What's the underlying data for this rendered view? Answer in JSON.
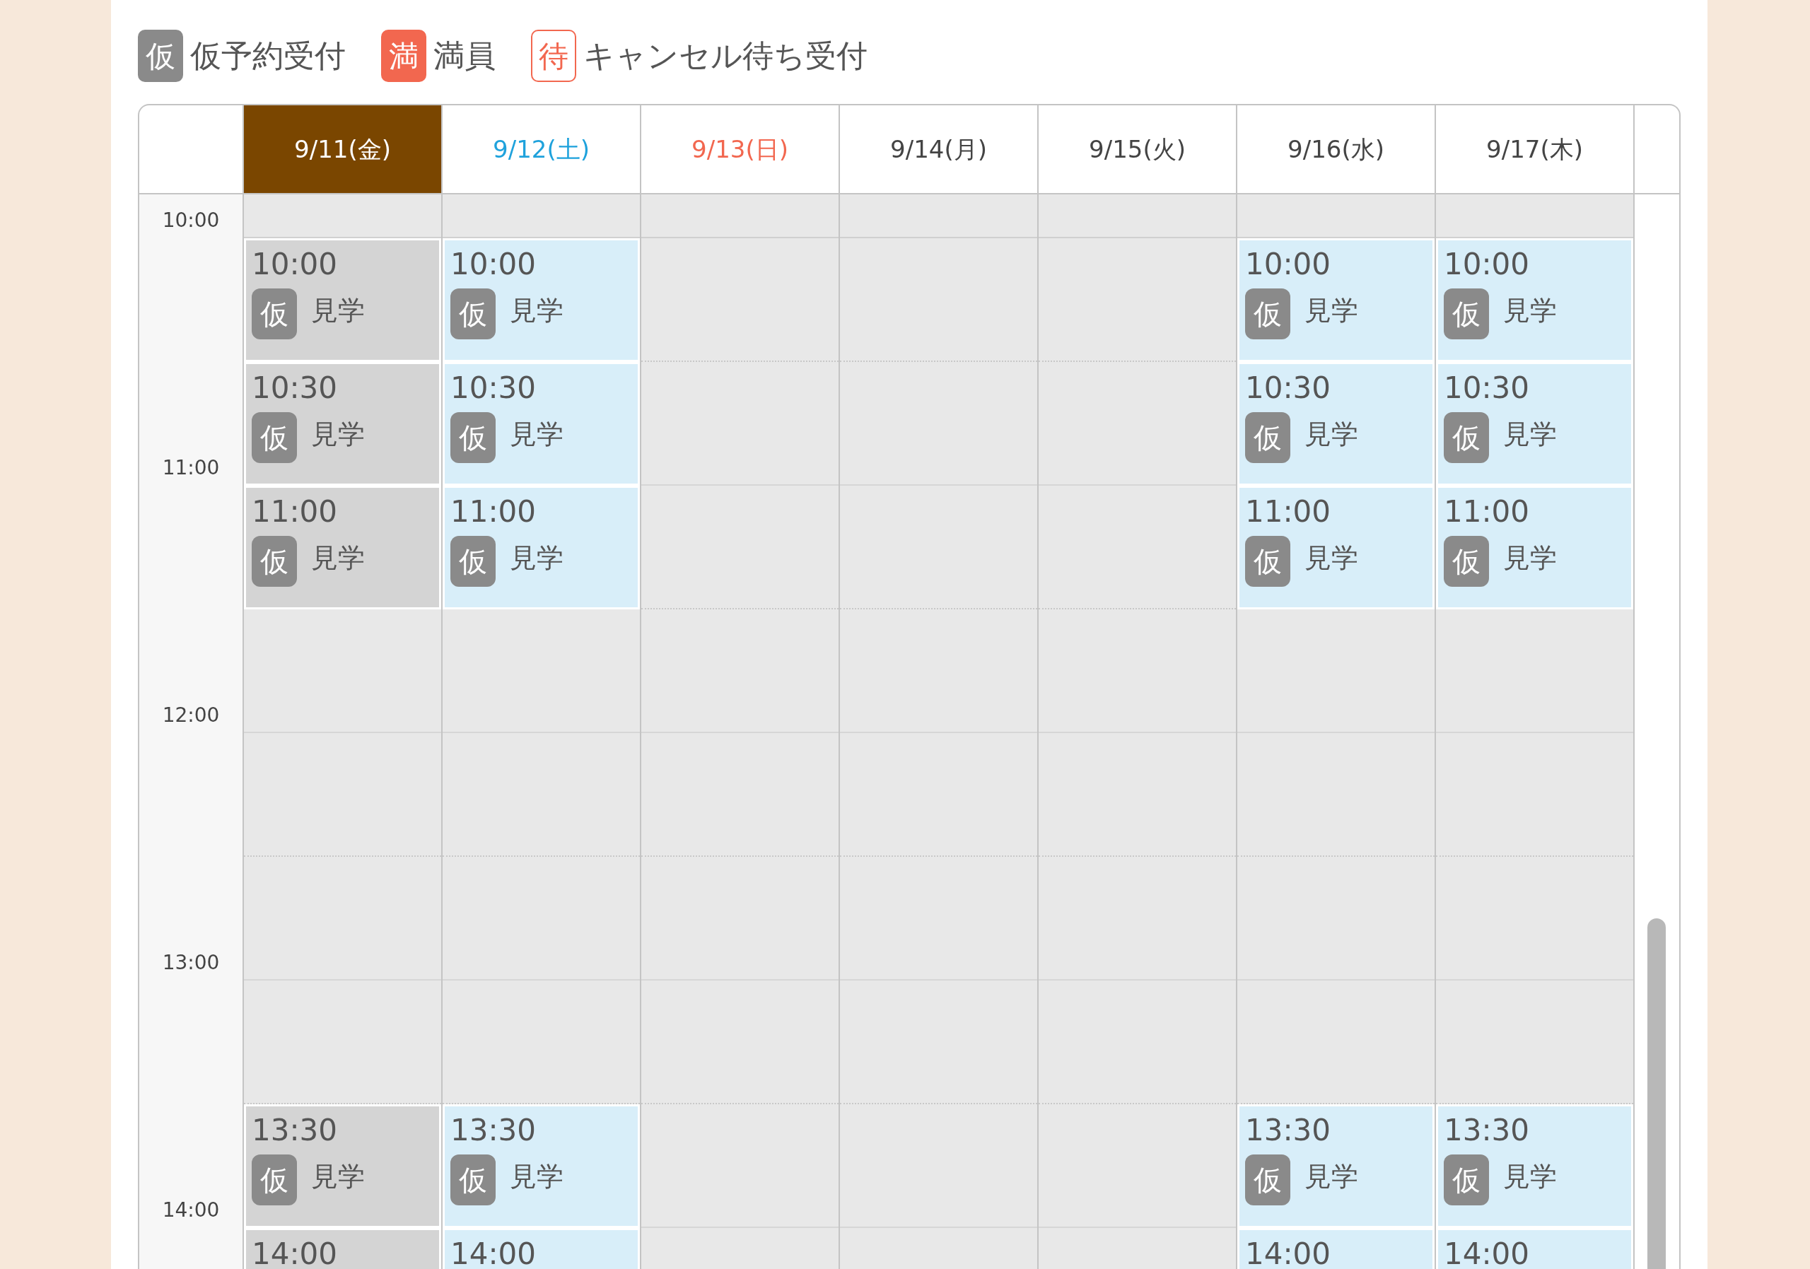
{
  "legend": [
    {
      "kind": "tentative",
      "icon": "仮",
      "label": "仮予約受付"
    },
    {
      "kind": "full",
      "icon": "満",
      "label": "満員"
    },
    {
      "kind": "waitlist",
      "icon": "待",
      "label": "キャンセル待ち受付"
    }
  ],
  "time_labels": [
    "10:00",
    "11:00",
    "12:00",
    "13:00",
    "14:00"
  ],
  "days": [
    {
      "label": "9/11(金)",
      "kind": "weekday",
      "selected": true,
      "cells": [
        {
          "kind": "open",
          "time": "10:00",
          "badge": "仮",
          "label": "見学"
        },
        {
          "kind": "open",
          "time": "10:30",
          "badge": "仮",
          "label": "見学"
        },
        {
          "kind": "open",
          "time": "11:00",
          "badge": "仮",
          "label": "見学"
        },
        {
          "kind": "empty"
        },
        {
          "kind": "empty"
        },
        {
          "kind": "empty"
        },
        {
          "kind": "empty"
        },
        {
          "kind": "open",
          "time": "13:30",
          "badge": "仮",
          "label": "見学"
        },
        {
          "kind": "open",
          "time": "14:00"
        }
      ]
    },
    {
      "label": "9/12(土)",
      "kind": "saturday",
      "selected": false,
      "cells": [
        {
          "kind": "open",
          "time": "10:00",
          "badge": "仮",
          "label": "見学"
        },
        {
          "kind": "open",
          "time": "10:30",
          "badge": "仮",
          "label": "見学"
        },
        {
          "kind": "open",
          "time": "11:00",
          "badge": "仮",
          "label": "見学"
        },
        {
          "kind": "empty"
        },
        {
          "kind": "empty"
        },
        {
          "kind": "empty"
        },
        {
          "kind": "empty"
        },
        {
          "kind": "open",
          "time": "13:30",
          "badge": "仮",
          "label": "見学"
        },
        {
          "kind": "open",
          "time": "14:00"
        }
      ]
    },
    {
      "label": "9/13(日)",
      "kind": "sunday",
      "selected": false,
      "cells": [
        {
          "kind": "empty"
        },
        {
          "kind": "empty"
        },
        {
          "kind": "empty"
        },
        {
          "kind": "empty"
        },
        {
          "kind": "empty"
        },
        {
          "kind": "empty"
        },
        {
          "kind": "empty"
        },
        {
          "kind": "empty"
        },
        {
          "kind": "empty"
        }
      ]
    },
    {
      "label": "9/14(月)",
      "kind": "weekday",
      "selected": false,
      "cells": [
        {
          "kind": "empty"
        },
        {
          "kind": "empty"
        },
        {
          "kind": "empty"
        },
        {
          "kind": "empty"
        },
        {
          "kind": "empty"
        },
        {
          "kind": "empty"
        },
        {
          "kind": "empty"
        },
        {
          "kind": "empty"
        },
        {
          "kind": "empty"
        }
      ]
    },
    {
      "label": "9/15(火)",
      "kind": "weekday",
      "selected": false,
      "cells": [
        {
          "kind": "empty"
        },
        {
          "kind": "empty"
        },
        {
          "kind": "empty"
        },
        {
          "kind": "empty"
        },
        {
          "kind": "empty"
        },
        {
          "kind": "empty"
        },
        {
          "kind": "empty"
        },
        {
          "kind": "empty"
        },
        {
          "kind": "empty"
        }
      ]
    },
    {
      "label": "9/16(水)",
      "kind": "weekday",
      "selected": false,
      "cells": [
        {
          "kind": "open",
          "time": "10:00",
          "badge": "仮",
          "label": "見学"
        },
        {
          "kind": "open",
          "time": "10:30",
          "badge": "仮",
          "label": "見学"
        },
        {
          "kind": "open",
          "time": "11:00",
          "badge": "仮",
          "label": "見学"
        },
        {
          "kind": "empty"
        },
        {
          "kind": "empty"
        },
        {
          "kind": "empty"
        },
        {
          "kind": "empty"
        },
        {
          "kind": "open",
          "time": "13:30",
          "badge": "仮",
          "label": "見学"
        },
        {
          "kind": "open",
          "time": "14:00"
        }
      ]
    },
    {
      "label": "9/17(木)",
      "kind": "weekday",
      "selected": false,
      "cells": [
        {
          "kind": "open",
          "time": "10:00",
          "badge": "仮",
          "label": "見学"
        },
        {
          "kind": "open",
          "time": "10:30",
          "badge": "仮",
          "label": "見学"
        },
        {
          "kind": "open",
          "time": "11:00",
          "badge": "仮",
          "label": "見学"
        },
        {
          "kind": "empty"
        },
        {
          "kind": "empty"
        },
        {
          "kind": "empty"
        },
        {
          "kind": "empty"
        },
        {
          "kind": "open",
          "time": "13:30",
          "badge": "仮",
          "label": "見学"
        },
        {
          "kind": "open",
          "time": "14:00"
        }
      ]
    }
  ]
}
